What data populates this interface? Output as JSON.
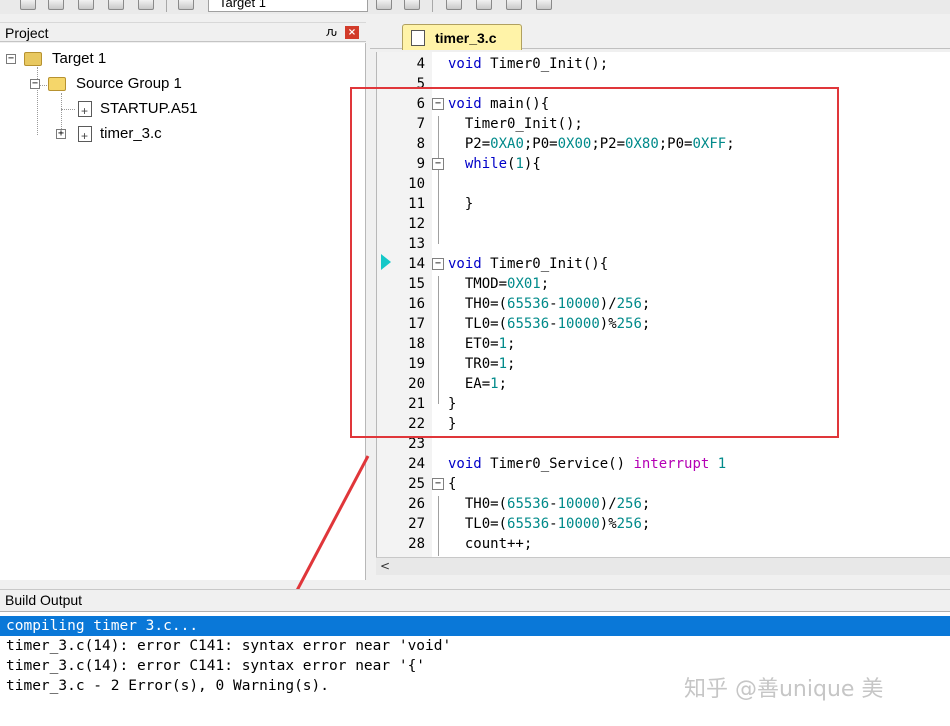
{
  "toolbar": {
    "target_select_value": "Target 1"
  },
  "project_panel": {
    "title": "Project",
    "pin_glyph": "ԉ",
    "close_glyph": "×",
    "tree": [
      {
        "label": "Target 1",
        "icon": "target-folder-icon",
        "expander": "−"
      },
      {
        "label": "Source Group 1",
        "icon": "folder-icon",
        "expander": "−"
      },
      {
        "label": "STARTUP.A51",
        "icon": "file-icon",
        "expander": ""
      },
      {
        "label": "timer_3.c",
        "icon": "file-icon",
        "expander": "+"
      }
    ]
  },
  "editor": {
    "tab_label": "timer_3.c",
    "scroll_left_glyph": "<",
    "lines": [
      {
        "n": "4",
        "text": "void Timer0_Init();"
      },
      {
        "n": "5",
        "text": ""
      },
      {
        "n": "6",
        "text": "void main(){"
      },
      {
        "n": "7",
        "text": "  Timer0_Init();"
      },
      {
        "n": "8",
        "text": "  P2=0XA0;P0=0X00;P2=0X80;P0=0XFF;"
      },
      {
        "n": "9",
        "text": "  while(1){"
      },
      {
        "n": "10",
        "text": ""
      },
      {
        "n": "11",
        "text": "  }"
      },
      {
        "n": "12",
        "text": ""
      },
      {
        "n": "13",
        "text": ""
      },
      {
        "n": "14",
        "text": "void Timer0_Init(){"
      },
      {
        "n": "15",
        "text": "  TMOD=0X01;"
      },
      {
        "n": "16",
        "text": "  TH0=(65536-10000)/256;"
      },
      {
        "n": "17",
        "text": "  TL0=(65536-10000)%256;"
      },
      {
        "n": "18",
        "text": "  ET0=1;"
      },
      {
        "n": "19",
        "text": "  TR0=1;"
      },
      {
        "n": "20",
        "text": "  EA=1;"
      },
      {
        "n": "21",
        "text": "}"
      },
      {
        "n": "22",
        "text": "}"
      },
      {
        "n": "23",
        "text": ""
      },
      {
        "n": "24",
        "text": "void Timer0_Service() interrupt 1"
      },
      {
        "n": "25",
        "text": "{"
      },
      {
        "n": "26",
        "text": "  TH0=(65536-10000)/256;"
      },
      {
        "n": "27",
        "text": "  TL0=(65536-10000)%256;"
      },
      {
        "n": "28",
        "text": "  count++;"
      }
    ]
  },
  "build_output": {
    "title": "Build Output",
    "lines": [
      "compiling timer 3.c...",
      "timer_3.c(14): error C141: syntax error near 'void'",
      "timer_3.c(14): error C141: syntax error near '{'",
      "timer_3.c - 2 Error(s), 0 Warning(s)."
    ]
  },
  "watermark": "知乎 @善unique 美",
  "colors": {
    "keyword": "#0000c8",
    "number": "#008a8a",
    "interrupt": "#b400b4",
    "highlight": "#e0363a",
    "selection": "#0a78d8"
  }
}
